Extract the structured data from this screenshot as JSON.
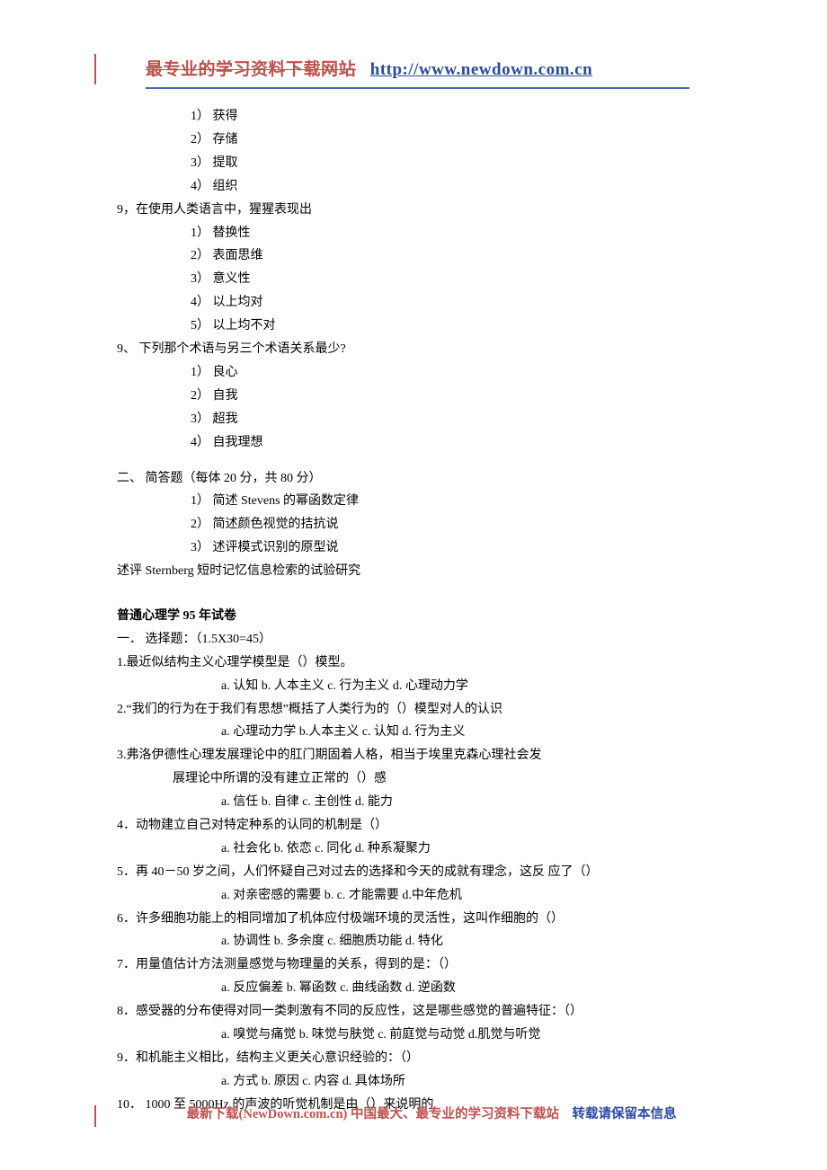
{
  "header": {
    "site_label": "最专业的学习资料下载网站",
    "url": "http://www.newdown.com.cn"
  },
  "lines": [
    {
      "cls": "opt-line",
      "text": "1）  获得"
    },
    {
      "cls": "opt-line",
      "text": "2）  存储"
    },
    {
      "cls": "opt-line",
      "text": "3）  提取"
    },
    {
      "cls": "opt-line",
      "text": "4）  组织"
    },
    {
      "cls": "q-line",
      "text": "9，在使用人类语言中，猩猩表现出"
    },
    {
      "cls": "opt-line",
      "text": "1）  替换性"
    },
    {
      "cls": "opt-line",
      "text": "2）  表面思维"
    },
    {
      "cls": "opt-line",
      "text": "3）  意义性"
    },
    {
      "cls": "opt-line",
      "text": "4）  以上均对"
    },
    {
      "cls": "opt-line",
      "text": "5）  以上均不对"
    },
    {
      "cls": "q-line",
      "text": "9、 下列那个术语与另三个术语关系最少?"
    },
    {
      "cls": "opt-line",
      "text": "1）  良心"
    },
    {
      "cls": "opt-line",
      "text": "2）  自我"
    },
    {
      "cls": "opt-line",
      "text": "3）  超我"
    },
    {
      "cls": "opt-line",
      "text": "4）  自我理想"
    },
    {
      "cls": "spacer",
      "text": ""
    },
    {
      "cls": "section-line",
      "text": "二、  简答题（每体 20 分，共 80 分）"
    },
    {
      "cls": "sub-line",
      "text": "1）  简述 Stevens 的幂函数定律"
    },
    {
      "cls": "sub-line",
      "text": "2）  简述颜色视觉的拮抗说"
    },
    {
      "cls": "sub-line",
      "text": "3）  述评模式识别的原型说"
    },
    {
      "cls": "plain",
      "text": "述评 Sternberg 短时记忆信息检索的试验研究"
    },
    {
      "cls": "spacer",
      "text": ""
    },
    {
      "cls": "title-line",
      "text": "普通心理学 95 年试卷"
    },
    {
      "cls": "plain",
      "text": "一．  选择题：（1.5X30=45）"
    },
    {
      "cls": "plain",
      "text": "1.最近似结构主义心理学模型是（）模型。"
    },
    {
      "cls": "choice-line",
      "text": "a. 认知      b. 人本主义        c. 行为主义      d. 心理动力学"
    },
    {
      "cls": "plain",
      "text": "2.“我们的行为在于我们有思想”概括了人类行为的（）模型对人的认识"
    },
    {
      "cls": "choice-line",
      "text": "a. 心理动力学       b.人本主义      c. 认知      d. 行为主义"
    },
    {
      "cls": "plain",
      "text": "3.弗洛伊德性心理发展理论中的肛门期固着人格，相当于埃里克森心理社会发"
    },
    {
      "cls": "indent1",
      "text": "展理论中所谓的没有建立正常的（）感"
    },
    {
      "cls": "choice-line",
      "text": "a. 信任      b. 自律      c. 主创性        d. 能力"
    },
    {
      "cls": "plain",
      "text": "4．动物建立自己对特定种系的认同的机制是（）"
    },
    {
      "cls": "choice-line",
      "text": "a. 社会化      b. 依恋        c. 同化      d. 种系凝聚力"
    },
    {
      "cls": "plain",
      "text": "5．再 40－50 岁之间，人们怀疑自己对过去的选择和今天的成就有理念，这反      应了（）"
    },
    {
      "cls": "choice-line",
      "text": "a. 对亲密感的需要    b.                 c. 才能需要     d.中年危机"
    },
    {
      "cls": "plain",
      "text": "6．许多细胞功能上的相同增加了机体应付极端环境的灵活性，这叫作细胞的（）"
    },
    {
      "cls": "choice-line",
      "text": "a. 协调性         b. 多余度        c. 细胞质功能       d. 特化"
    },
    {
      "cls": "plain",
      "text": "7．用量值估计方法测量感觉与物理量的关系，得到的是：（）"
    },
    {
      "cls": "choice-line",
      "text": "a. 反应偏差      b. 幂函数      c. 曲线函数       d. 逆函数"
    },
    {
      "cls": "plain",
      "text": "8．感受器的分布使得对同一类刺激有不同的反应性，这是哪些感觉的普遍特征：（）"
    },
    {
      "cls": "choice-line",
      "text": "a. 嗅觉与痛觉     b. 味觉与肤觉     c. 前庭觉与动觉     d.肌觉与听觉"
    },
    {
      "cls": "plain",
      "text": "9．和机能主义相比，结构主义更关心意识经验的：（）"
    },
    {
      "cls": "choice-line",
      "text": "a. 方式       b. 原因     c. 内容       d. 具体场所"
    },
    {
      "cls": "plain",
      "text": "10．  1000 至 5000Hz 的声波的听觉机制是由（）来说明的"
    }
  ],
  "footer": {
    "part1": "最新下载(NewDown.com.cn)  中国最大、最专业的学习资料下载站",
    "part2": "转载请保留本信息"
  }
}
